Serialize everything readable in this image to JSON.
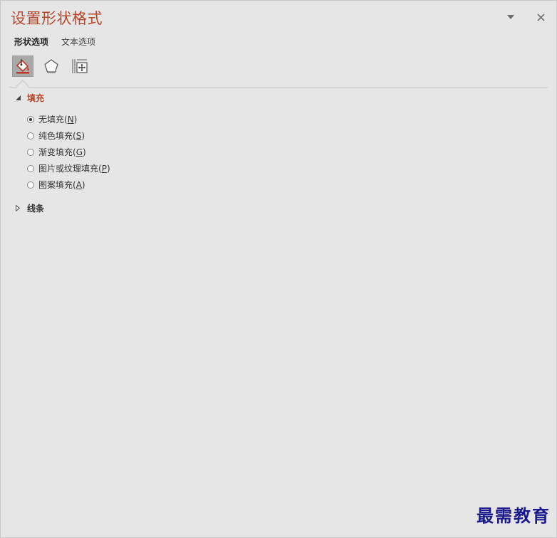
{
  "pane": {
    "title": "设置形状格式",
    "accent_color": "#b7472a",
    "header_icons": [
      "chevron-down-icon",
      "close-icon"
    ]
  },
  "tabs": [
    {
      "label": "形状选项",
      "active": true
    },
    {
      "label": "文本选项",
      "active": false
    }
  ],
  "category_icons": [
    {
      "name": "fill-line-icon",
      "selected": true
    },
    {
      "name": "effects-pentagon-icon",
      "selected": false
    },
    {
      "name": "size-properties-icon",
      "selected": false
    }
  ],
  "sections": {
    "fill": {
      "label": "填充",
      "expanded": true,
      "options": [
        {
          "label": "无填充(",
          "key": "N",
          "suffix": ")",
          "checked": true
        },
        {
          "label": "纯色填充(",
          "key": "S",
          "suffix": ")",
          "checked": false
        },
        {
          "label": "渐变填充(",
          "key": "G",
          "suffix": ")",
          "checked": false
        },
        {
          "label": "图片或纹理填充(",
          "key": "P",
          "suffix": ")",
          "checked": false
        },
        {
          "label": "图案填充(",
          "key": "A",
          "suffix": ")",
          "checked": false
        }
      ]
    },
    "line": {
      "label": "线条",
      "expanded": false
    }
  },
  "watermark": "最需教育"
}
